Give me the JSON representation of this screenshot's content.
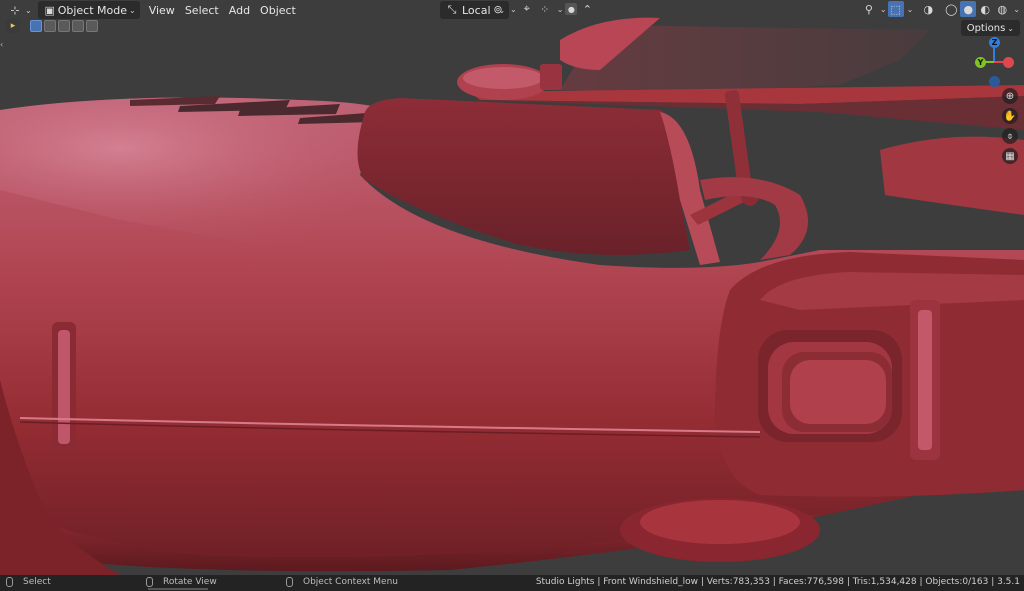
{
  "header": {
    "mode": "Object Mode",
    "menus": [
      "View",
      "Select",
      "Add",
      "Object"
    ],
    "orientation": "Local",
    "options": "Options"
  },
  "gizmo": {
    "z": "Z",
    "y": "Y"
  },
  "statusbar": {
    "select": "Select",
    "rotate": "Rotate View",
    "context": "Object Context Menu",
    "stats": "Studio Lights | Front Windshield_low | Verts:783,353 | Faces:776,598 | Tris:1,534,428 | Objects:0/163 | 3.5.1"
  },
  "colors": {
    "viewport_bg": "#3d3d3d",
    "car_body": "#a8363d",
    "accent": "#4772b3",
    "axis_z": "#2f7fe0",
    "axis_y": "#7fc41f",
    "axis_x": "#e0464f"
  },
  "icons": [
    "editor-type-icon",
    "object-mode-icon",
    "transform-orientation-icon",
    "pivot-icon",
    "snap-icon",
    "proportional-edit-icon",
    "gizmo-visibility-icon",
    "overlay-icon",
    "xray-icon",
    "shading-wireframe-icon",
    "shading-solid-icon",
    "shading-material-icon",
    "shading-rendered-icon",
    "zoom-icon",
    "hand-pan-icon",
    "camera-icon",
    "grid-toggle-icon"
  ]
}
